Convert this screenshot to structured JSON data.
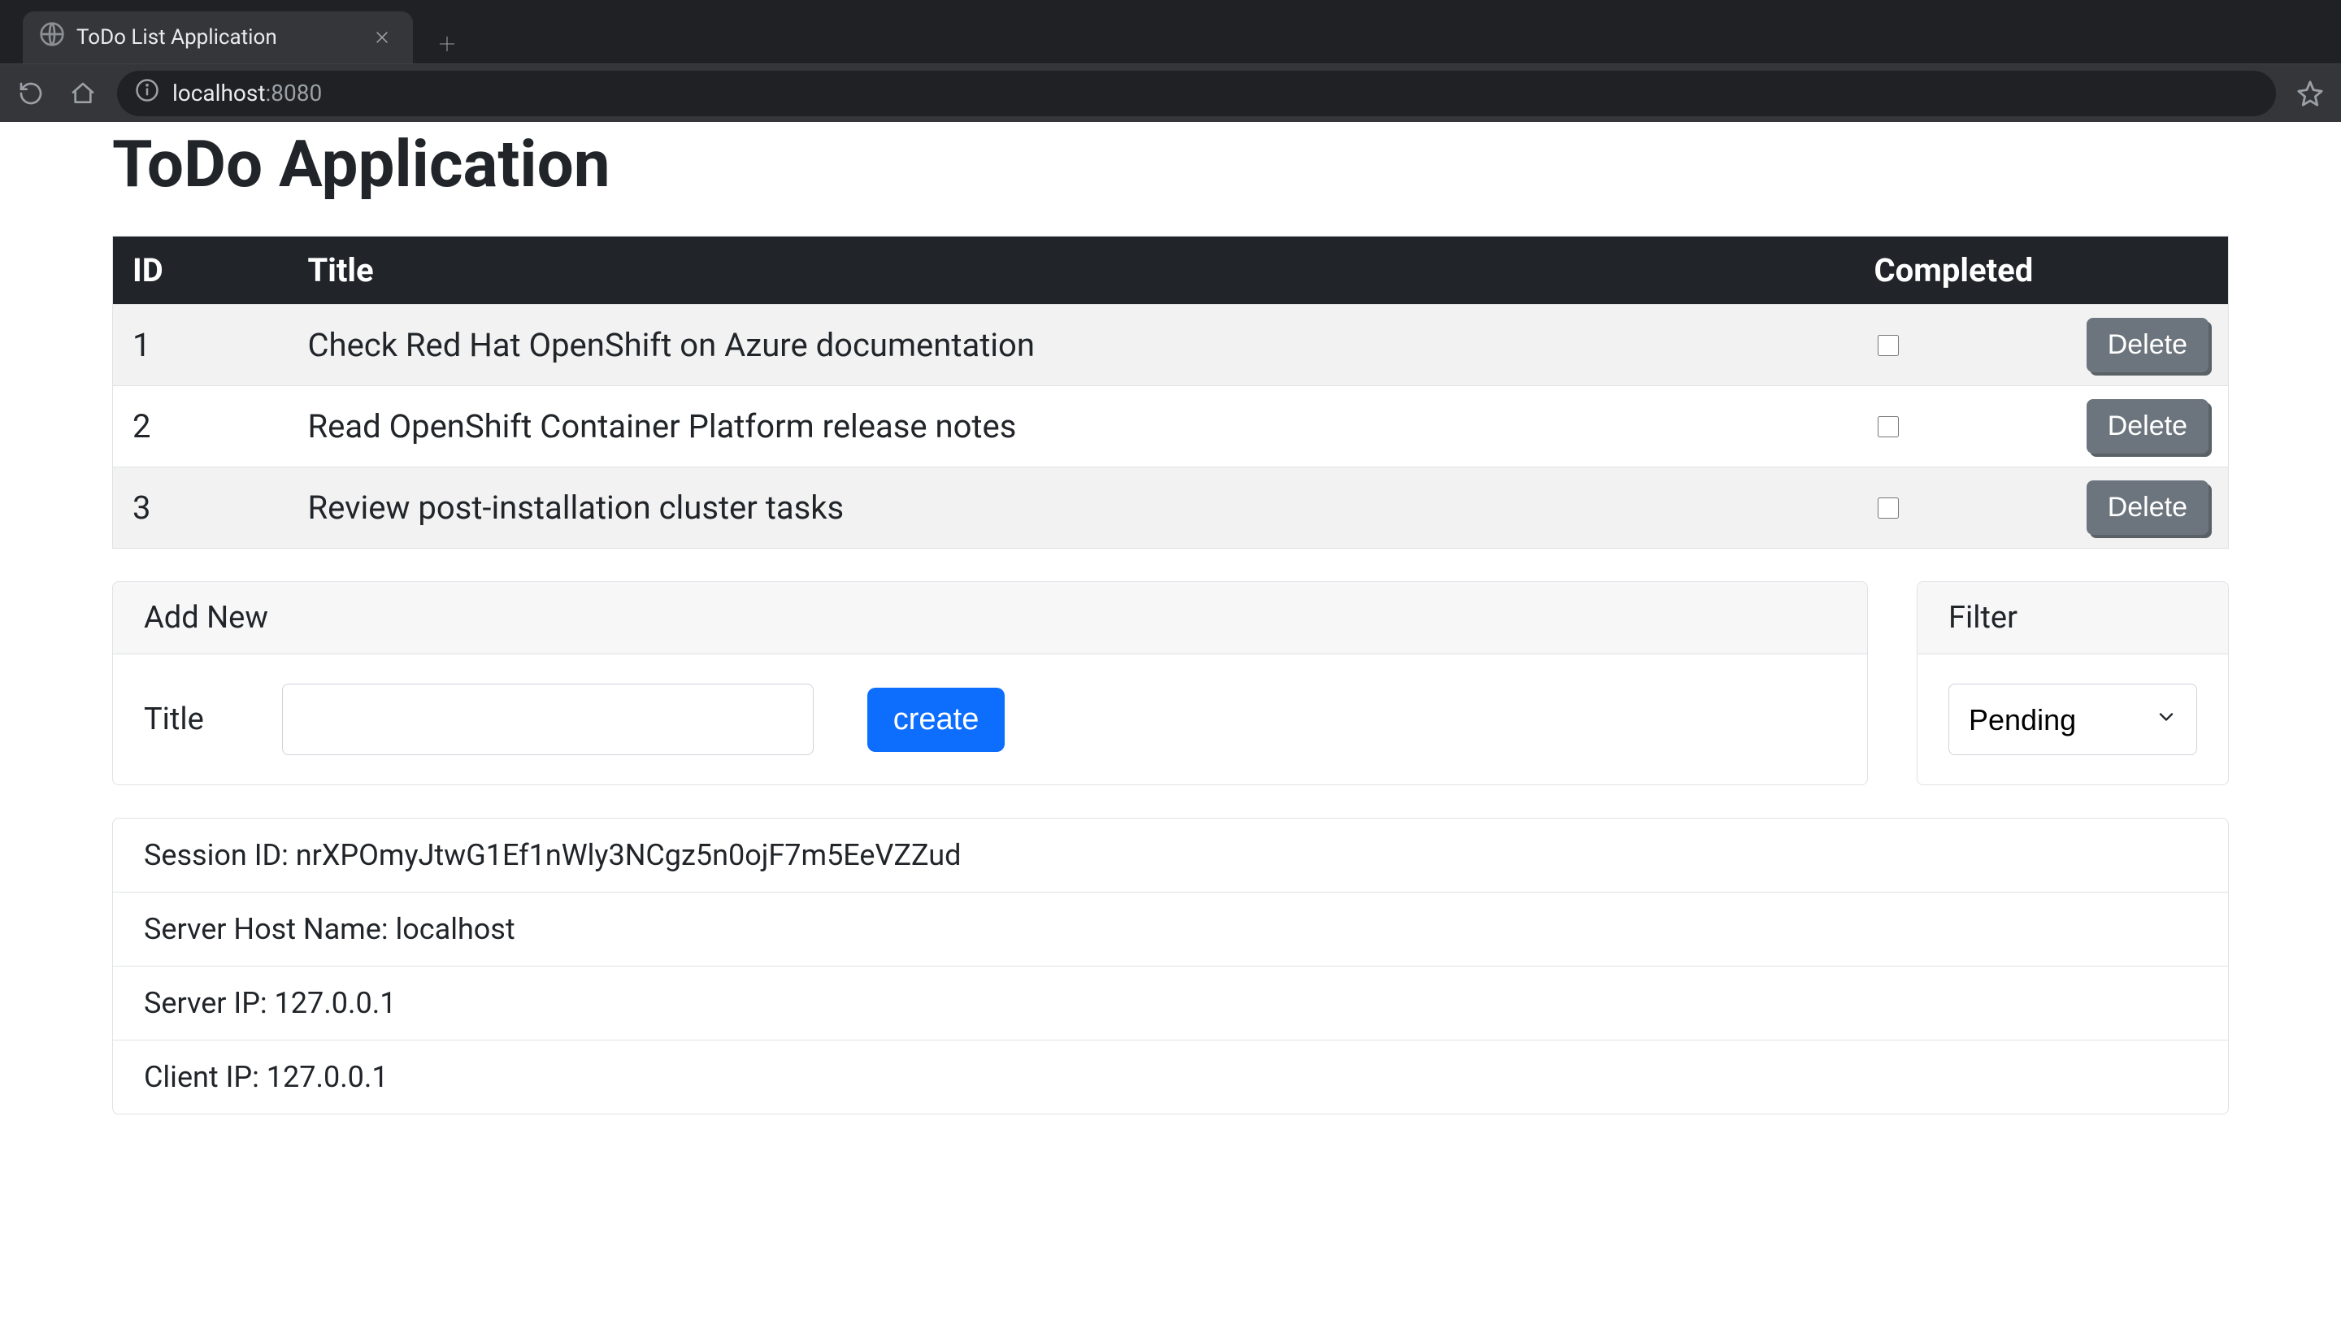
{
  "browser": {
    "tab_title": "ToDo List Application",
    "url_host": "localhost",
    "url_port": ":8080"
  },
  "app": {
    "title": "ToDo Application"
  },
  "table": {
    "headers": {
      "id": "ID",
      "title": "Title",
      "completed": "Completed"
    },
    "rows": [
      {
        "id": "1",
        "title": "Check Red Hat OpenShift on Azure documentation",
        "completed": false,
        "delete_label": "Delete"
      },
      {
        "id": "2",
        "title": "Read OpenShift Container Platform release notes",
        "completed": false,
        "delete_label": "Delete"
      },
      {
        "id": "3",
        "title": "Review post-installation cluster tasks",
        "completed": false,
        "delete_label": "Delete"
      }
    ]
  },
  "add_new": {
    "header": "Add New",
    "title_label": "Title",
    "title_value": "",
    "create_label": "create"
  },
  "filter": {
    "header": "Filter",
    "selected": "Pending"
  },
  "info": {
    "session_id": "Session ID: nrXPOmyJtwG1Ef1nWly3NCgz5n0ojF7m5EeVZZud",
    "server_host": "Server Host Name: localhost",
    "server_ip": "Server IP: 127.0.0.1",
    "client_ip": "Client IP: 127.0.0.1"
  }
}
